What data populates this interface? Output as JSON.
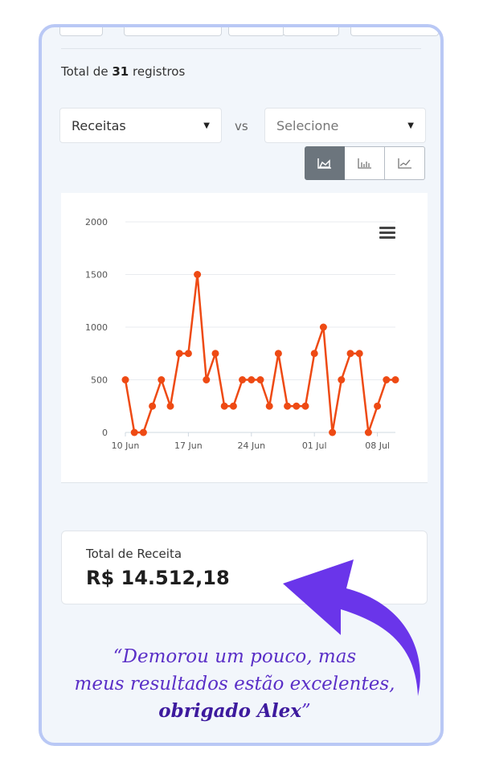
{
  "summary": {
    "prefix": "Total de",
    "count": "31",
    "suffix": "registros"
  },
  "filters": {
    "metric": "Receitas",
    "vs": "vs",
    "compare_placeholder": "Selecione"
  },
  "chart_types": [
    "area-chart-icon",
    "bar-chart-icon",
    "line-chart-icon"
  ],
  "chart_data": {
    "type": "line",
    "title": "",
    "xlabel": "",
    "ylabel": "",
    "ylim": [
      0,
      2000
    ],
    "yticks": [
      "0",
      "500",
      "1000",
      "1500",
      "2000"
    ],
    "xticks": [
      {
        "label": "10 Jun",
        "index": 0
      },
      {
        "label": "17 Jun",
        "index": 7
      },
      {
        "label": "24 Jun",
        "index": 14
      },
      {
        "label": "01 Jul",
        "index": 21
      },
      {
        "label": "08 Jul",
        "index": 28
      }
    ],
    "series": [
      {
        "color": "#ee4a14",
        "values": [
          500,
          0,
          0,
          250,
          500,
          250,
          750,
          750,
          1500,
          500,
          750,
          250,
          250,
          500,
          500,
          500,
          250,
          750,
          250,
          250,
          250,
          750,
          1000,
          0,
          500,
          750,
          750,
          0,
          250,
          500,
          500
        ]
      }
    ],
    "grid": true
  },
  "result": {
    "label": "Total de Receita",
    "value": "R$ 14.512,18"
  },
  "testimonial": {
    "line1": "“Demorou um pouco, mas",
    "line2": "meus resultados estão excelentes,",
    "line3_bold": "obrigado Alex",
    "line3_tail": "”"
  },
  "colors": {
    "accent": "#ee4a14",
    "quote": "#5a2fc7",
    "arrow": "#6a35ea",
    "frame": "#b9c8f5"
  }
}
